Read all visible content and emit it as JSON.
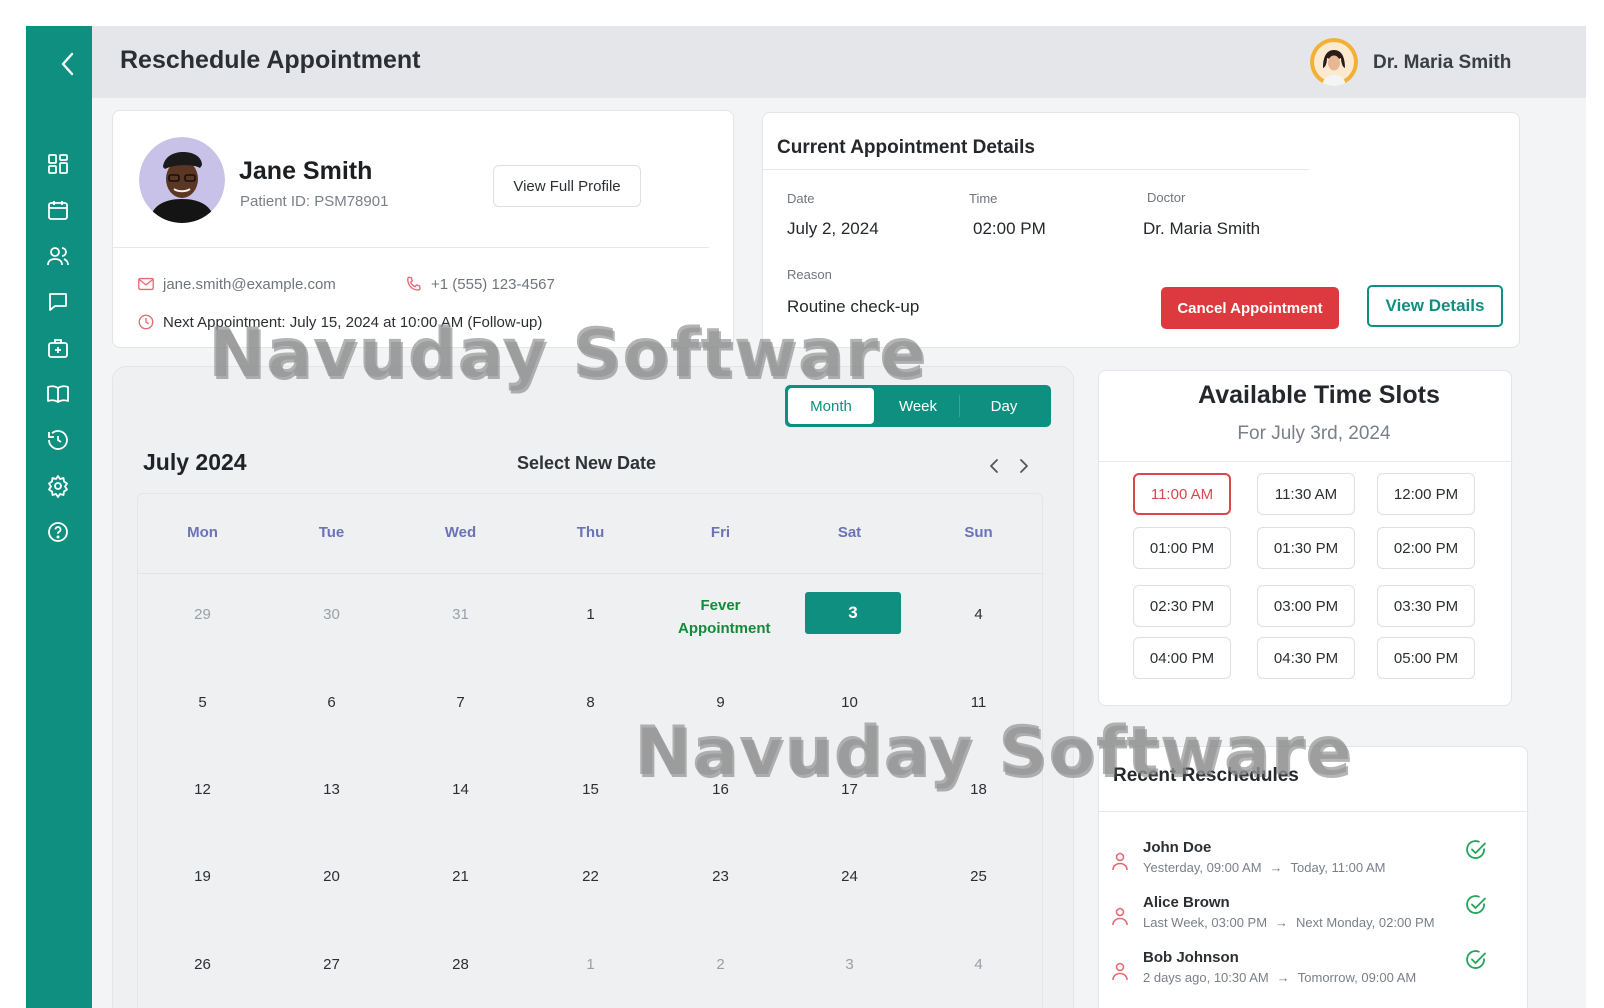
{
  "header": {
    "title": "Reschedule Appointment",
    "user_name": "Dr. Maria Smith"
  },
  "sidebar": {
    "items": [
      "back-icon",
      "dashboard-icon",
      "calendar-icon",
      "users-icon",
      "chat-icon",
      "medical-bag-icon",
      "book-icon",
      "history-icon",
      "settings-icon",
      "help-icon"
    ]
  },
  "patient": {
    "name": "Jane Smith",
    "id_label": "Patient ID: PSM78901",
    "view_profile": "View Full Profile",
    "email": "jane.smith@example.com",
    "phone": "+1 (555) 123-4567",
    "next_appointment": "Next Appointment: July 15, 2024 at 10:00 AM (Follow-up)"
  },
  "details": {
    "title": "Current Appointment Details",
    "date_label": "Date",
    "date": "July 2, 2024",
    "time_label": "Time",
    "time": "02:00 PM",
    "doctor_label": "Doctor",
    "doctor": "Dr. Maria Smith",
    "reason_label": "Reason",
    "reason": "Routine check-up",
    "cancel": "Cancel Appointment",
    "view": "View Details"
  },
  "calendar": {
    "views": [
      "Month",
      "Week",
      "Day"
    ],
    "active_view": "Month",
    "month_label": "July 2024",
    "subtitle": "Select New Date",
    "weekdays": [
      "Mon",
      "Tue",
      "Wed",
      "Thu",
      "Fri",
      "Sat",
      "Sun"
    ],
    "weeks": [
      [
        "29",
        "30",
        "31",
        "1",
        "Fever Appointment",
        "3",
        "4"
      ],
      [
        "5",
        "6",
        "7",
        "8",
        "9",
        "10",
        "11"
      ],
      [
        "12",
        "13",
        "14",
        "15",
        "16",
        "17",
        "18"
      ],
      [
        "19",
        "20",
        "21",
        "22",
        "23",
        "24",
        "25"
      ],
      [
        "26",
        "27",
        "28",
        "1",
        "2",
        "3",
        "4"
      ]
    ],
    "selected_day": "3"
  },
  "slots": {
    "title": "Available Time Slots",
    "subtitle": "For July 3rd, 2024",
    "times": [
      "11:00 AM",
      "11:30 AM",
      "12:00 PM",
      "01:00 PM",
      "01:30 PM",
      "02:00 PM",
      "02:30 PM",
      "03:00 PM",
      "03:30 PM",
      "04:00 PM",
      "04:30 PM",
      "05:00 PM"
    ],
    "selected": "11:00 AM"
  },
  "recent": {
    "title": "Recent Reschedules",
    "items": [
      {
        "name": "John Doe",
        "from": "Yesterday, 09:00 AM",
        "to": "Today, 11:00 AM"
      },
      {
        "name": "Alice Brown",
        "from": "Last Week, 03:00 PM",
        "to": "Next Monday, 02:00 PM"
      },
      {
        "name": "Bob Johnson",
        "from": "2 days ago, 10:30 AM",
        "to": "Tomorrow, 09:00 AM"
      }
    ]
  },
  "watermark": "Navuday Software",
  "colors": {
    "primary": "#0f8f7f",
    "danger": "#dc3a3f",
    "event": "#148a3a",
    "weekday": "#6b72b8"
  }
}
